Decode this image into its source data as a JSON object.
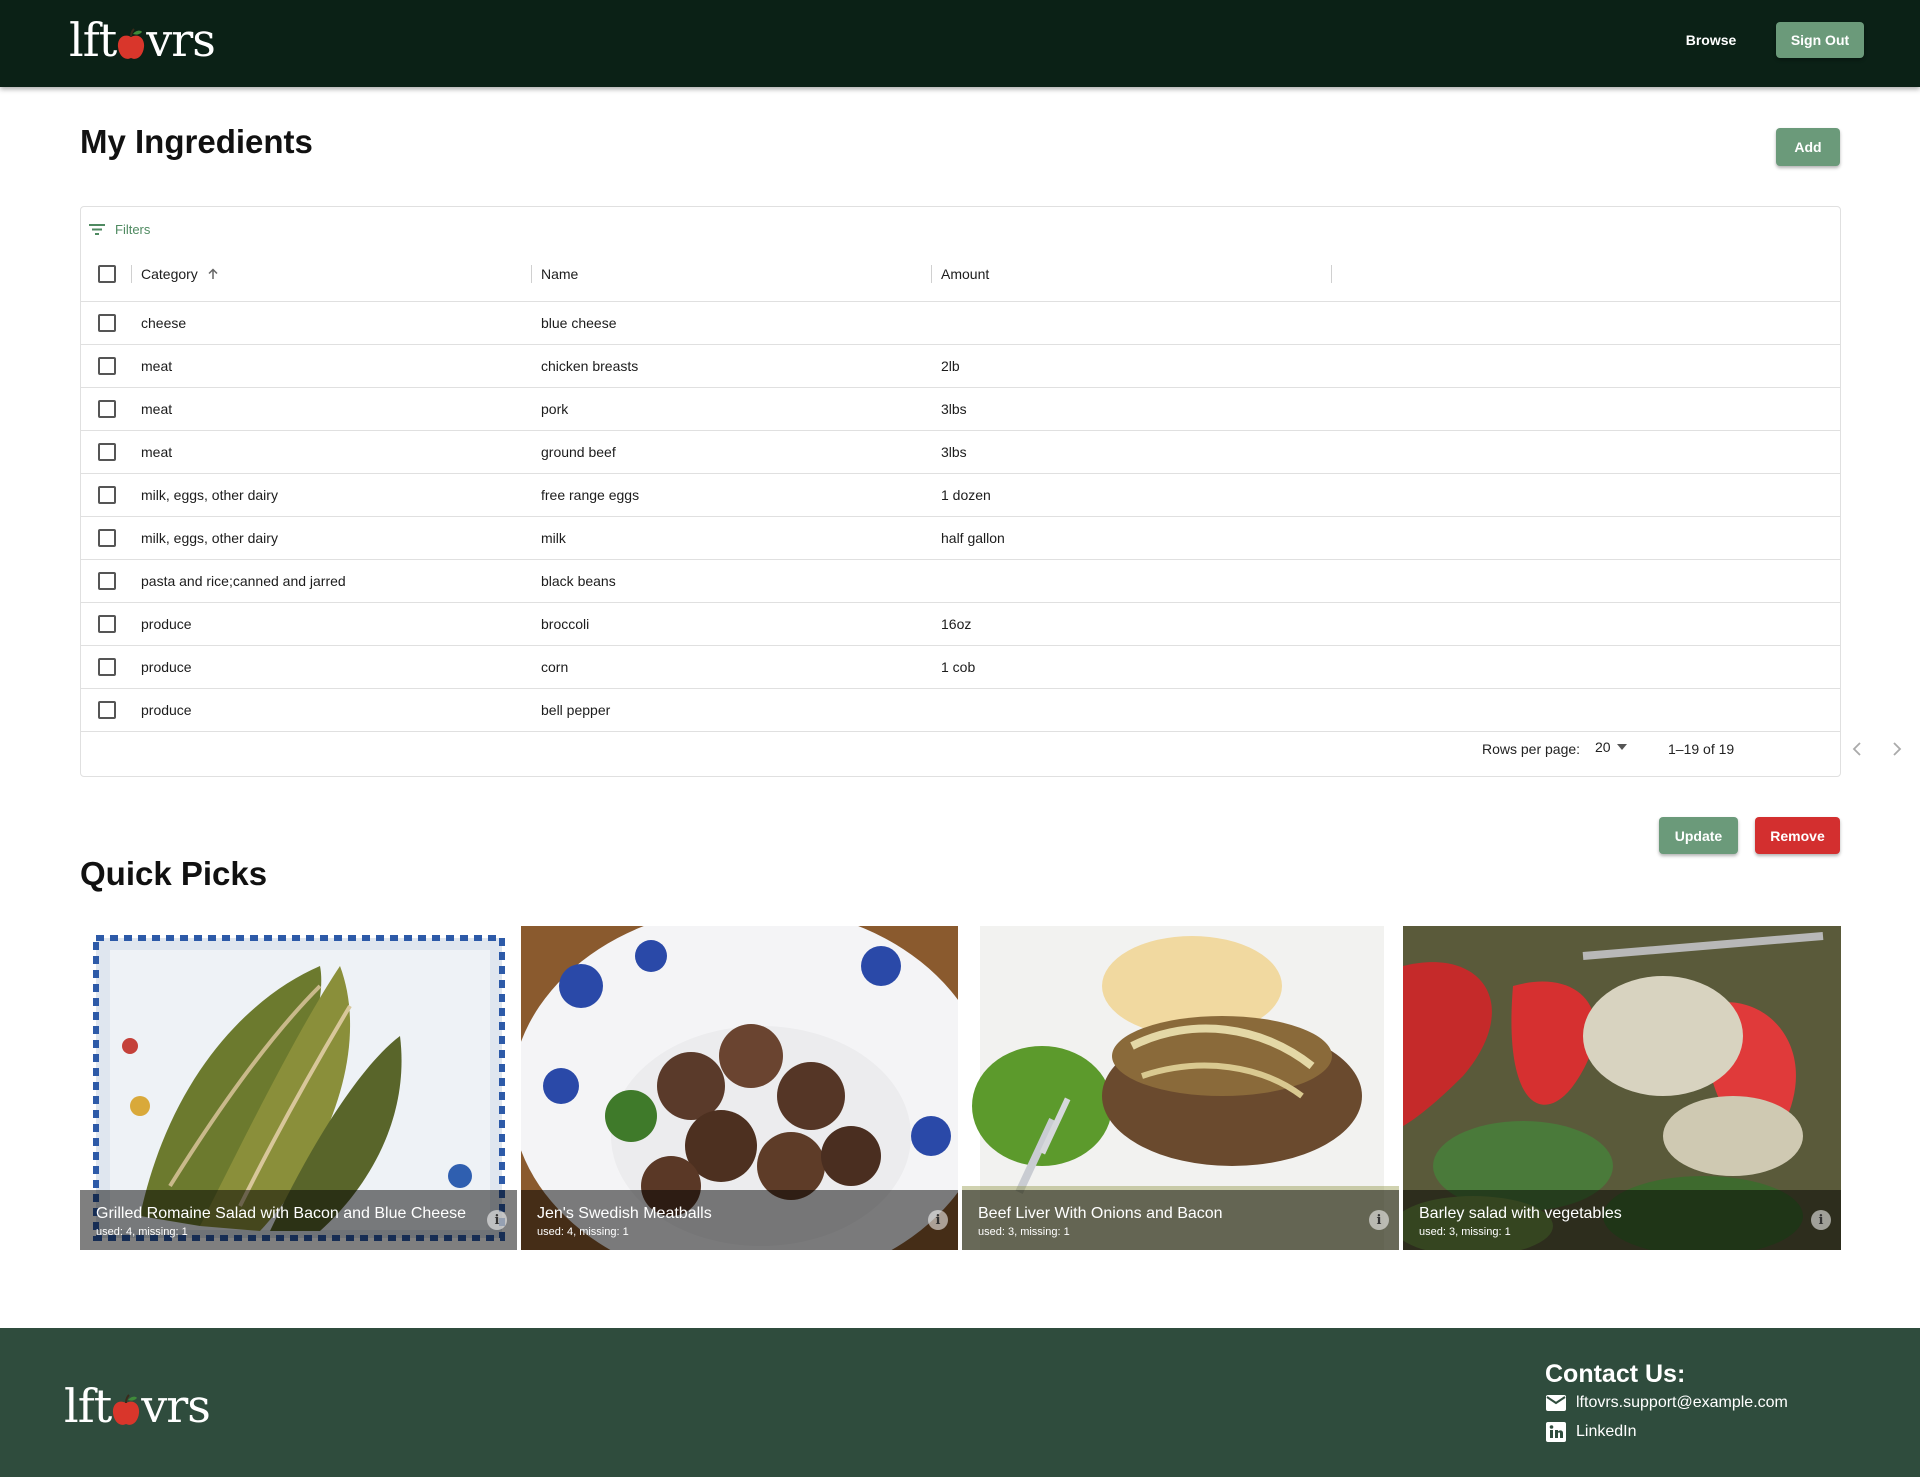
{
  "brand": {
    "logo_left": "lft",
    "logo_right": "vrs"
  },
  "nav": {
    "browse_label": "Browse",
    "signout_label": "Sign Out"
  },
  "page": {
    "title": "My Ingredients",
    "add_label": "Add"
  },
  "grid": {
    "filters_label": "Filters",
    "columns": [
      "Category",
      "Name",
      "Amount"
    ],
    "rows": [
      {
        "category": "cheese",
        "name": "blue cheese",
        "amount": ""
      },
      {
        "category": "meat",
        "name": "chicken breasts",
        "amount": "2lb"
      },
      {
        "category": "meat",
        "name": "pork",
        "amount": "3lbs"
      },
      {
        "category": "meat",
        "name": "ground beef",
        "amount": "3lbs"
      },
      {
        "category": "milk, eggs, other dairy",
        "name": "free range eggs",
        "amount": "1 dozen"
      },
      {
        "category": "milk, eggs, other dairy",
        "name": "milk",
        "amount": "half gallon"
      },
      {
        "category": "pasta and rice;canned and jarred",
        "name": "black beans",
        "amount": ""
      },
      {
        "category": "produce",
        "name": "broccoli",
        "amount": "16oz"
      },
      {
        "category": "produce",
        "name": "corn",
        "amount": "1 cob"
      },
      {
        "category": "produce",
        "name": "bell pepper",
        "amount": ""
      }
    ],
    "rows_per_page_label": "Rows per page:",
    "rows_per_page_value": "20",
    "page_info": "1–19 of 19"
  },
  "actions": {
    "update_label": "Update",
    "remove_label": "Remove"
  },
  "quick_picks": {
    "title": "Quick Picks",
    "items": [
      {
        "title": "Grilled Romaine Salad with Bacon and Blue Cheese",
        "subtitle": "used: 4, missing: 1"
      },
      {
        "title": "Jen's Swedish Meatballs",
        "subtitle": "used: 4, missing: 1"
      },
      {
        "title": "Beef Liver With Onions and Bacon",
        "subtitle": "used: 3, missing: 1"
      },
      {
        "title": "Barley salad with vegetables",
        "subtitle": "used: 3, missing: 1"
      }
    ]
  },
  "footer": {
    "contact_title": "Contact Us:",
    "email": "lftovrs.support@example.com",
    "linkedin": "LinkedIn"
  },
  "colors": {
    "navbar": "#0b2116",
    "footer": "#2f4c3d",
    "accent_green": "#6b9a7a",
    "danger": "#d32f2f",
    "link_green": "#4f8a61"
  }
}
